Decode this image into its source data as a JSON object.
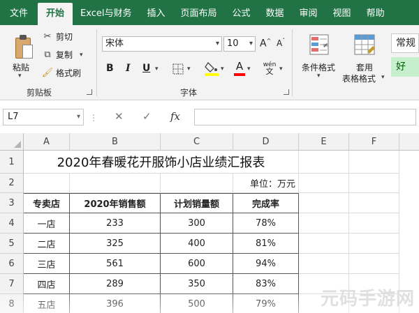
{
  "tabs": [
    {
      "label": "文件"
    },
    {
      "label": "开始"
    },
    {
      "label": "Excel与财务"
    },
    {
      "label": "插入"
    },
    {
      "label": "页面布局"
    },
    {
      "label": "公式"
    },
    {
      "label": "数据"
    },
    {
      "label": "审阅"
    },
    {
      "label": "视图"
    },
    {
      "label": "帮助"
    }
  ],
  "ribbon": {
    "clipboard": {
      "paste": "粘贴",
      "cut": "剪切",
      "copy": "复制",
      "format_painter": "格式刷",
      "group_label": "剪贴板"
    },
    "font": {
      "font_name": "宋体",
      "font_size": "10",
      "bold": "B",
      "italic": "I",
      "underline": "U",
      "grow": "A",
      "shrink": "A",
      "font_color": "A",
      "phonetic": "wén",
      "group_label": "字体"
    },
    "styles": {
      "conditional": "条件格式",
      "table_format_1": "套用",
      "table_format_2": "表格格式",
      "normal": "常规",
      "good": "好"
    }
  },
  "formula_bar": {
    "name_box": "L7",
    "cancel": "✕",
    "enter": "✓",
    "fx": "fx",
    "value": ""
  },
  "columns": [
    "A",
    "B",
    "C",
    "D",
    "E",
    "F"
  ],
  "rows": [
    "1",
    "2",
    "3",
    "4",
    "5",
    "6",
    "7",
    "8"
  ],
  "sheet": {
    "title": "2020年春暖花开服饰小店业绩汇报表",
    "unit": "单位：万元",
    "headers": [
      "专卖店",
      "2020年销售额",
      "计划销量额",
      "完成率"
    ],
    "data": [
      [
        "一店",
        "233",
        "300",
        "78%"
      ],
      [
        "二店",
        "325",
        "400",
        "81%"
      ],
      [
        "三店",
        "561",
        "600",
        "94%"
      ],
      [
        "四店",
        "289",
        "350",
        "83%"
      ],
      [
        "五店",
        "396",
        "500",
        "79%"
      ]
    ]
  },
  "watermark": "元码手游网",
  "colors": {
    "excel_green": "#217346"
  }
}
